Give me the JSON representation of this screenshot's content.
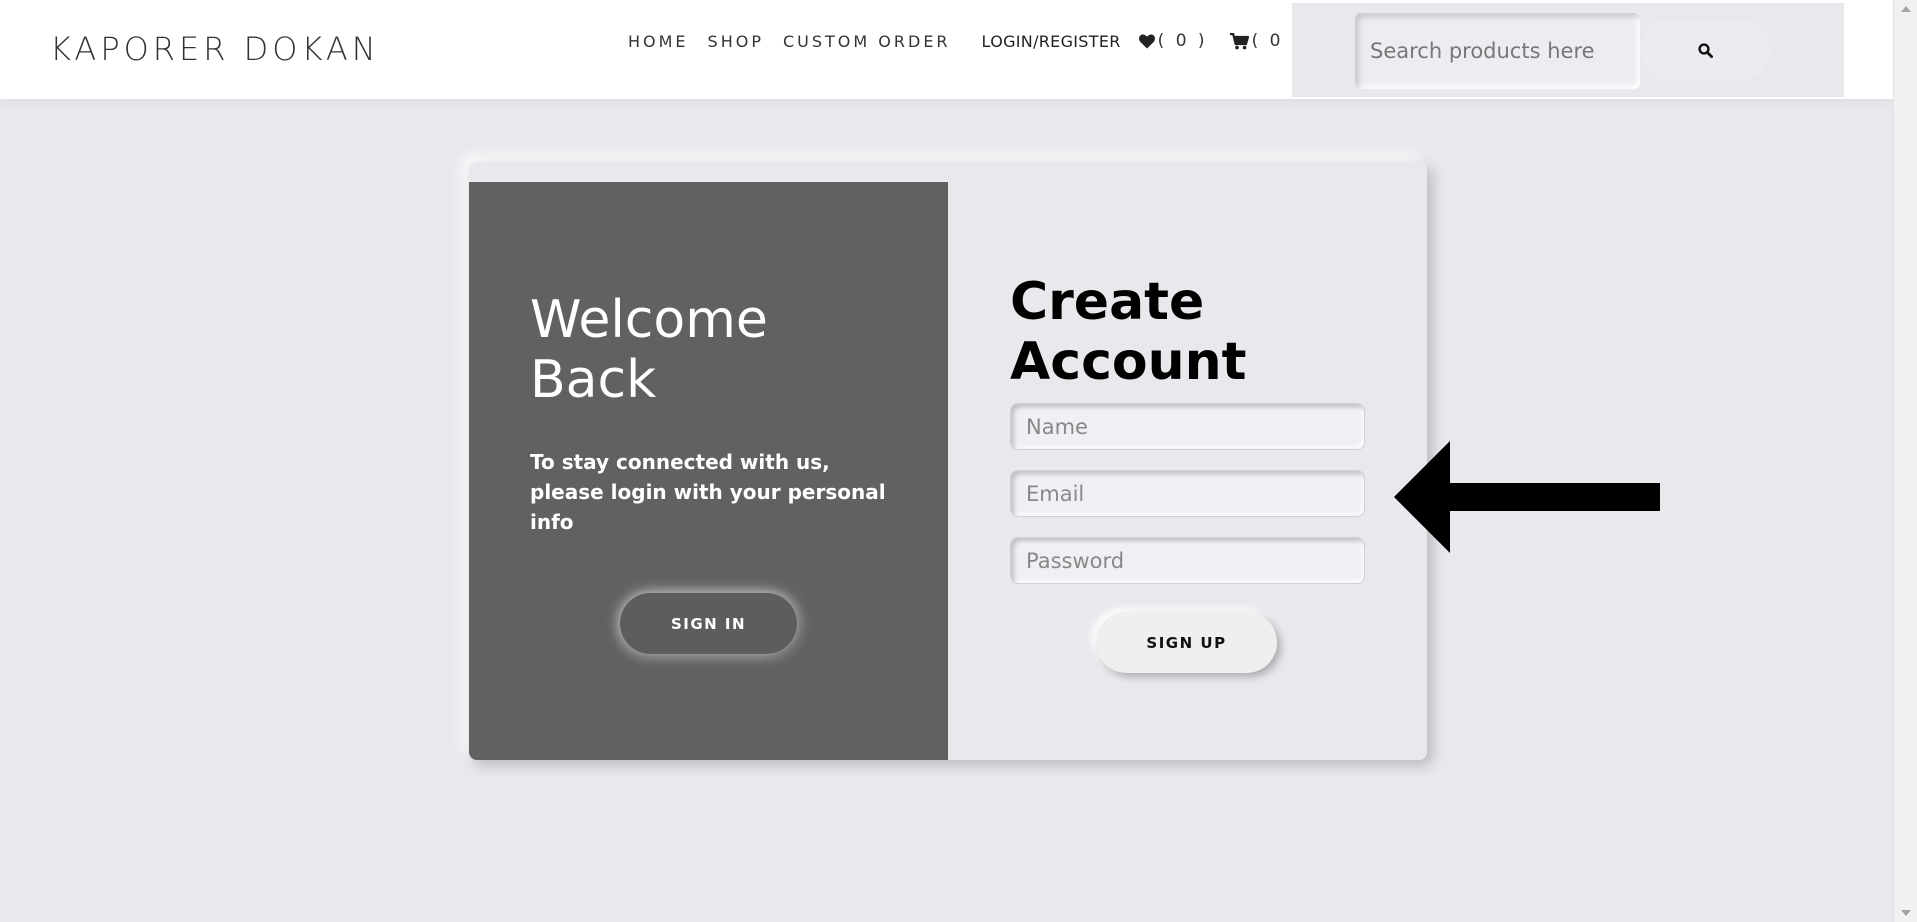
{
  "header": {
    "logo": "KAPORER DOKAN",
    "nav": [
      {
        "label": "HOME"
      },
      {
        "label": "SHOP"
      },
      {
        "label": "CUSTOM ORDER"
      }
    ],
    "login_label": "LOGIN/REGISTER",
    "wishlist_count": "( 0 )",
    "cart_count": "( 0 )",
    "search": {
      "placeholder": "Search products here",
      "icon": "search-icon"
    }
  },
  "welcome": {
    "title": "Welcome Back",
    "text": "To stay connected with us, please login with your personal info",
    "signin_label": "SIGN IN"
  },
  "signup": {
    "title": "Create Account",
    "name_placeholder": "Name",
    "email_placeholder": "Email",
    "password_placeholder": "Password",
    "signup_label": "SIGN UP"
  },
  "icons": {
    "wishlist": "heart-icon",
    "cart": "cart-icon",
    "annotation": "arrow-left-icon"
  },
  "colors": {
    "background": "#e8e9ed",
    "left_panel": "#616161",
    "header": "#ffffff"
  }
}
